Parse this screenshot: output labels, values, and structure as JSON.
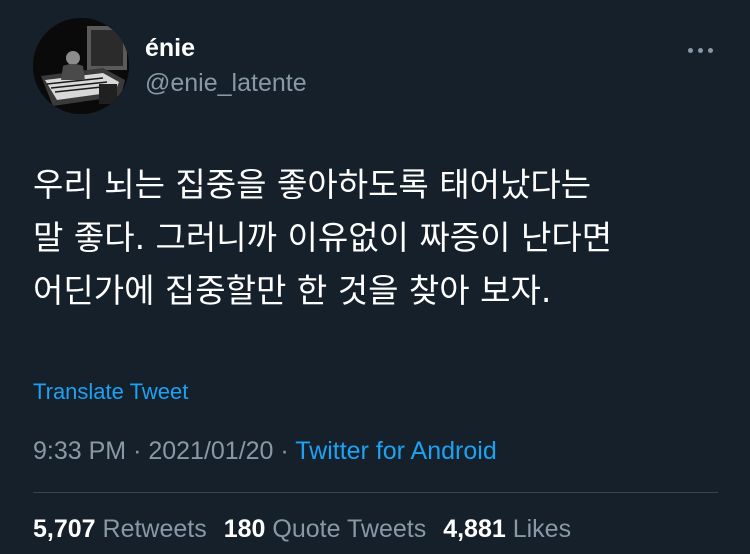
{
  "author": {
    "display_name": "énie",
    "handle": "@enie_latente"
  },
  "menu": {
    "icon": "more-horizontal-icon"
  },
  "tweet": {
    "lines": [
      "우리 뇌는 집중을 좋아하도록 태어났다는",
      "말 좋다. 그러니까 이유없이 짜증이 난다면",
      "어딘가에 집중할만 한 것을 찾아 보자."
    ],
    "translate_label": "Translate Tweet"
  },
  "meta": {
    "time": "9:33 PM",
    "separator": "·",
    "date": "2021/01/20",
    "source": "Twitter for Android"
  },
  "stats": {
    "retweets": {
      "count": "5,707",
      "label": "Retweets"
    },
    "quotes": {
      "count": "180",
      "label": "Quote Tweets"
    },
    "likes": {
      "count": "4,881",
      "label": "Likes"
    }
  },
  "colors": {
    "background": "#15202b",
    "accent": "#1da1f2",
    "secondary_text": "#8899a6",
    "divider": "#38444d"
  }
}
